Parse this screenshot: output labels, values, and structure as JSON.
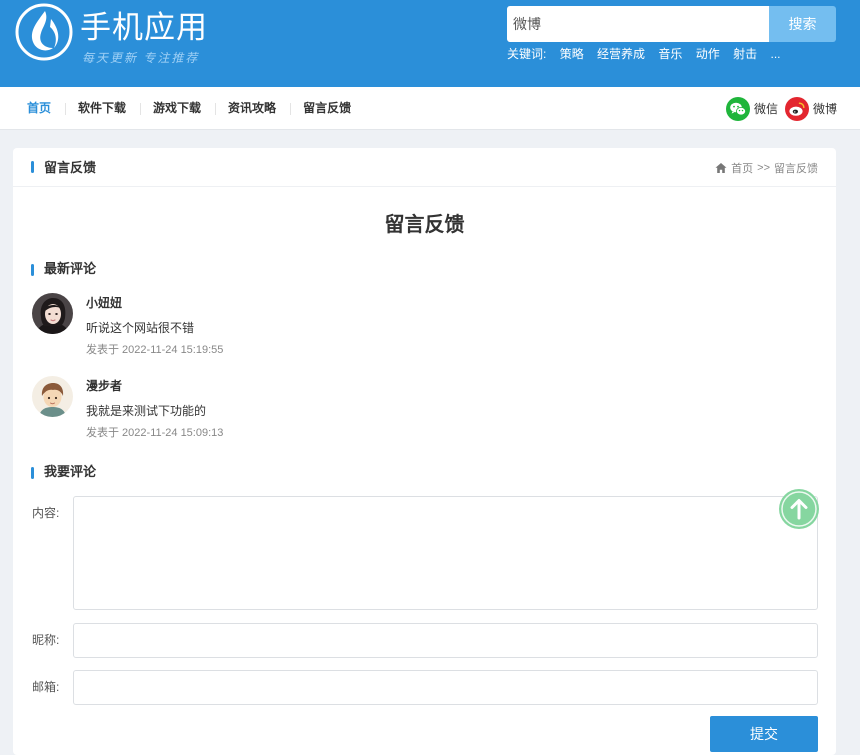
{
  "header": {
    "logo": {
      "title": "手机应用",
      "slogan": "每天更新 专注推荐"
    },
    "search": {
      "value": "微博",
      "button_label": "搜索"
    },
    "keywords_label": "关键词:",
    "keywords": [
      "策略",
      "经营养成",
      "音乐",
      "动作",
      "射击",
      "..."
    ]
  },
  "nav": {
    "items": [
      "首页",
      "软件下载",
      "游戏下载",
      "资讯攻略",
      "留言反馈"
    ],
    "active_index": 0,
    "social": {
      "wechat": "微信",
      "weibo": "微博"
    }
  },
  "card": {
    "title": "留言反馈",
    "breadcrumb": {
      "home": "首页",
      "separator": ">>",
      "current": "留言反馈"
    }
  },
  "page_heading": "留言反馈",
  "latest_comments": {
    "title": "最新评论",
    "items": [
      {
        "author": "小妞妞",
        "content": "听说这个网站很不错",
        "posted": "发表于 2022-11-24 15:19:55"
      },
      {
        "author": "漫步者",
        "content": "我就是来测试下功能的",
        "posted": "发表于 2022-11-24 15:09:13"
      }
    ]
  },
  "comment_form": {
    "title": "我要评论",
    "content_label": "内容:",
    "nickname_label": "昵称:",
    "email_label": "邮箱:",
    "submit_label": "提交"
  },
  "icons": {
    "logo": "flame-logo-icon",
    "home": "home-icon",
    "wechat": "wechat-icon",
    "weibo": "weibo-icon",
    "back_to_top": "arrow-up-icon"
  },
  "colors": {
    "primary": "#2b8fd9",
    "search_button": "#74bef0",
    "back_to_top": "#86d6a0",
    "wechat": "#1fb53b",
    "weibo": "#e3262f",
    "page_background": "#eef1f5"
  }
}
